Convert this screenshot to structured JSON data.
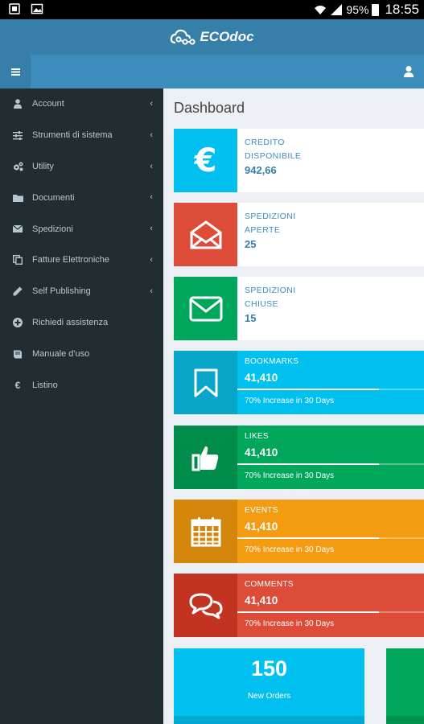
{
  "status_bar": {
    "battery": "95%",
    "time": "18:55"
  },
  "app": {
    "brand": "ECOdoc"
  },
  "sidebar": {
    "items": [
      {
        "label": "Account",
        "icon": "user-icon",
        "has_submenu": true
      },
      {
        "label": "Strumenti di sistema",
        "icon": "sliders-icon",
        "has_submenu": true
      },
      {
        "label": "Utility",
        "icon": "cogs-icon",
        "has_submenu": true
      },
      {
        "label": "Documenti",
        "icon": "folder-icon",
        "has_submenu": true
      },
      {
        "label": "Spedizioni",
        "icon": "envelope-icon",
        "has_submenu": true
      },
      {
        "label": "Fatture Elettroniche",
        "icon": "copy-icon",
        "has_submenu": true
      },
      {
        "label": "Self Publishing",
        "icon": "pencil-icon",
        "has_submenu": true
      },
      {
        "label": "Richiedi assistenza",
        "icon": "plus-circle-icon",
        "has_submenu": false
      },
      {
        "label": "Manuale d'uso",
        "icon": "book-icon",
        "has_submenu": false
      },
      {
        "label": "Listino",
        "icon": "euro-icon",
        "has_submenu": false
      }
    ]
  },
  "main": {
    "title": "Dashboard",
    "info_boxes": [
      {
        "line1": "CREDITO",
        "line2": "DISPONIBILE",
        "value": "942,66",
        "icon": "euro-icon",
        "color": "#00c0ef"
      },
      {
        "line1": "SPEDIZIONI",
        "line2": "APERTE",
        "value": "25",
        "icon": "envelope-open-icon",
        "color": "#dd4b39"
      },
      {
        "line1": "SPEDIZIONI",
        "line2": "CHIUSE",
        "value": "15",
        "icon": "envelope-icon",
        "color": "#00a65a"
      }
    ],
    "colored_boxes": [
      {
        "label": "BOOKMARKS",
        "value": "41,410",
        "progress": 70,
        "description": "70% Increase in 30 Days",
        "icon": "bookmark-icon",
        "color": "#00c0ef",
        "icon_bg": "#0aa6c9"
      },
      {
        "label": "LIKES",
        "value": "41,410",
        "progress": 70,
        "description": "70% Increase in 30 Days",
        "icon": "thumbs-up-icon",
        "color": "#00a65a",
        "icon_bg": "#008d4c"
      },
      {
        "label": "EVENTS",
        "value": "41,410",
        "progress": 70,
        "description": "70% Increase in 30 Days",
        "icon": "calendar-icon",
        "color": "#f39c12",
        "icon_bg": "#d4860b"
      },
      {
        "label": "COMMENTS",
        "value": "41,410",
        "progress": 70,
        "description": "70% Increase in 30 Days",
        "icon": "comments-icon",
        "color": "#dd4b39",
        "icon_bg": "#c23321"
      }
    ],
    "small_boxes": [
      {
        "value": "150",
        "label": "New Orders",
        "color": "#00c0ef"
      },
      {
        "value": "",
        "label": "",
        "color": "#00a65a"
      }
    ]
  }
}
